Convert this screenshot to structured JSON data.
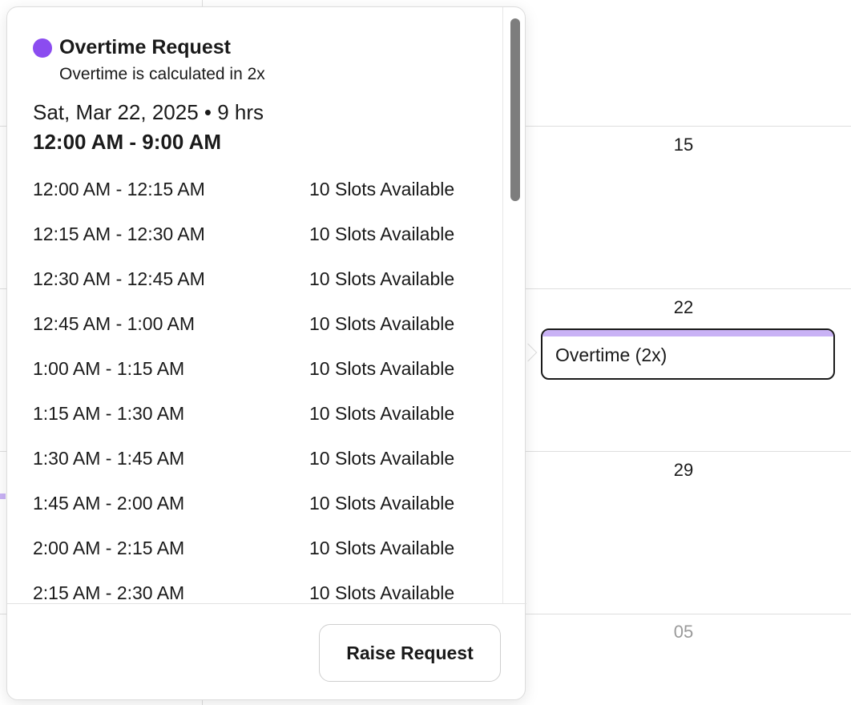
{
  "calendar": {
    "dates": [
      {
        "label": "15",
        "muted": false
      },
      {
        "label": "22",
        "muted": false
      },
      {
        "label": "29",
        "muted": false
      },
      {
        "label": "05",
        "muted": true
      }
    ],
    "event": {
      "label": "Overtime (2x)",
      "color": "#c9b2f5"
    }
  },
  "popover": {
    "title": "Overtime Request",
    "dot_color": "#8b4cf0",
    "subtitle": "Overtime is calculated in 2x",
    "date_line": "Sat, Mar 22, 2025 • 9 hrs",
    "range_line": "12:00 AM - 9:00 AM",
    "slots": [
      {
        "time": "12:00 AM - 12:15 AM",
        "availability": "10 Slots Available"
      },
      {
        "time": "12:15 AM - 12:30 AM",
        "availability": "10 Slots Available"
      },
      {
        "time": "12:30 AM - 12:45 AM",
        "availability": "10 Slots Available"
      },
      {
        "time": "12:45 AM - 1:00 AM",
        "availability": "10 Slots Available"
      },
      {
        "time": "1:00 AM - 1:15 AM",
        "availability": "10 Slots Available"
      },
      {
        "time": "1:15 AM - 1:30 AM",
        "availability": "10 Slots Available"
      },
      {
        "time": "1:30 AM - 1:45 AM",
        "availability": "10 Slots Available"
      },
      {
        "time": "1:45 AM - 2:00 AM",
        "availability": "10 Slots Available"
      },
      {
        "time": "2:00 AM - 2:15 AM",
        "availability": "10 Slots Available"
      },
      {
        "time": "2:15 AM - 2:30 AM",
        "availability": "10 Slots Available"
      }
    ],
    "raise_button_label": "Raise Request"
  }
}
